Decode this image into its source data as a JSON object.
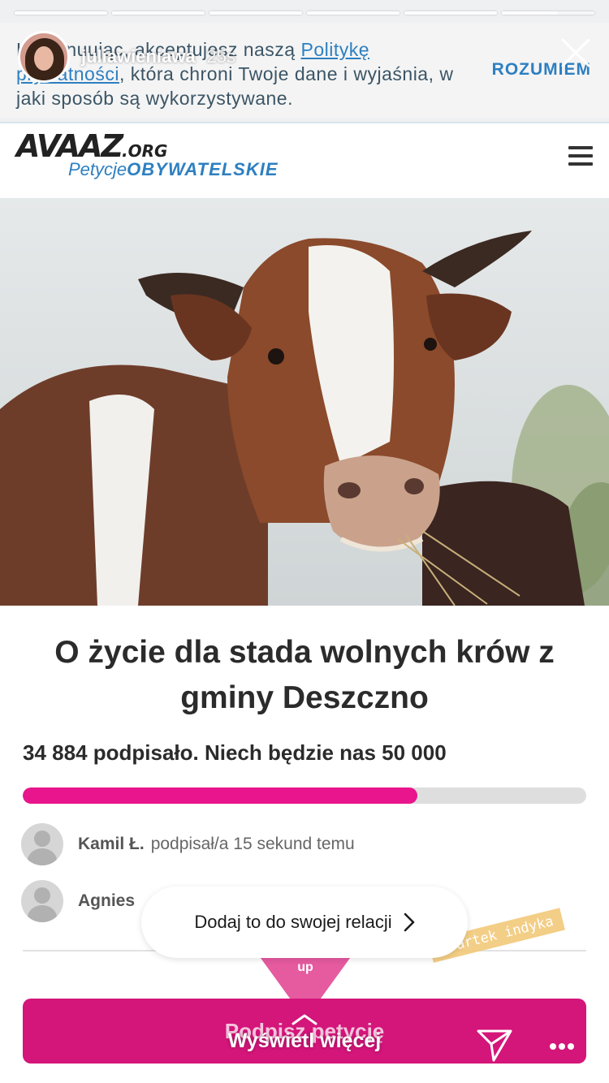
{
  "story": {
    "username": "juliawieniawa",
    "time_ago": "25s",
    "segments": 6,
    "add_to_story_label": "Dodaj to do swojej relacji",
    "swipe_label": "Wyświetl więcej"
  },
  "cookie_banner": {
    "text_part1": "Kontynuując, akceptujesz naszą ",
    "link_text": "Politykę prywatności",
    "text_part2": ", która chroni Twoje dane i wyjaśnia, w jaki sposób są wykorzystywane.",
    "accept_label": "ROZUMIEM"
  },
  "site": {
    "logo_main": "AVAAZ",
    "logo_tld": ".ORG",
    "logo_sub_a": "Petycje",
    "logo_sub_b": "OBYWATELSKIE"
  },
  "petition": {
    "title": "O życie dla stada wolnych krów z gminy Deszczno",
    "count_text": "34 884 podpisało. Niech będzie nas 50 000",
    "progress_fraction": 0.7,
    "signers": [
      {
        "name": "Kamil Ł.",
        "action": "podpisał/a 15 sekund temu"
      },
      {
        "name": "Agnies",
        "action": ""
      }
    ],
    "sign_button_label": "Podpisz petycję"
  },
  "sticker": {
    "heart_text": "up",
    "tag_text": "#bartek indyka"
  },
  "colors": {
    "accent_pink": "#e8158c",
    "link_blue": "#2d7fc1",
    "button_pink": "#d4157a"
  },
  "icons": [
    "close-icon",
    "hamburger-icon",
    "chevron-right-icon",
    "chevron-up-icon",
    "send-icon",
    "more-icon"
  ]
}
